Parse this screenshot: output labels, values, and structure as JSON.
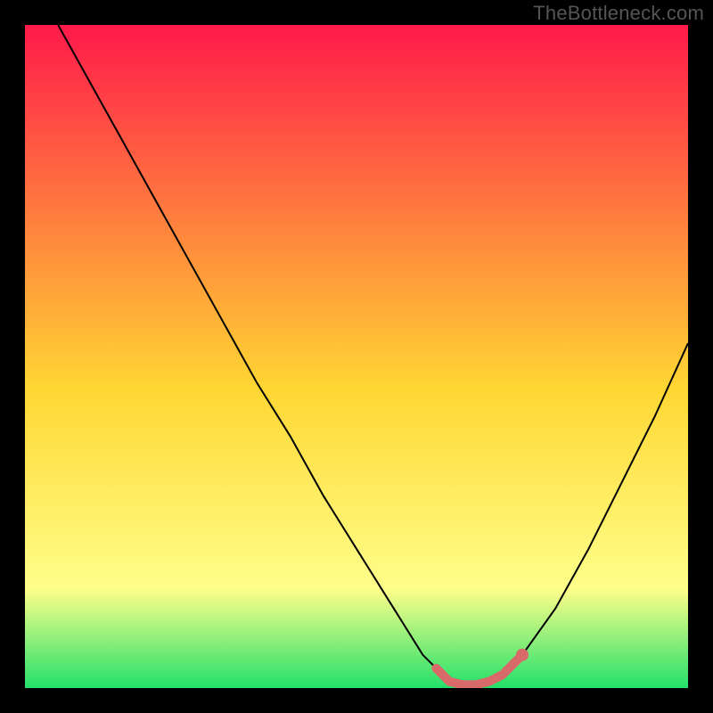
{
  "watermark": "TheBottleneck.com",
  "colors": {
    "background": "#000000",
    "gradient_top": "#ff1a4a",
    "gradient_mid": "#ffd733",
    "gradient_low": "#ffff8a",
    "gradient_bottom": "#23e06a",
    "curve_stroke": "#000000",
    "marker_fill": "#d96a6a",
    "marker_stroke": "#d96a6a"
  },
  "chart_data": {
    "type": "line",
    "title": "",
    "xlabel": "",
    "ylabel": "",
    "xlim": [
      0,
      100
    ],
    "ylim": [
      0,
      100
    ],
    "x": [
      5,
      10,
      15,
      20,
      25,
      30,
      35,
      40,
      45,
      50,
      55,
      60,
      62,
      64,
      66,
      68,
      70,
      72,
      75,
      80,
      85,
      90,
      95,
      100
    ],
    "series": [
      {
        "name": "curve",
        "values": [
          100,
          91,
          82,
          73,
          64,
          55,
          46,
          38,
          29,
          21,
          13,
          5,
          3,
          1,
          0.5,
          0.5,
          1,
          2,
          5,
          12,
          21,
          31,
          41,
          52
        ]
      }
    ],
    "markers": {
      "name": "highlighted-range",
      "x": [
        62,
        64,
        66,
        68,
        70,
        72,
        75
      ],
      "y": [
        3,
        1,
        0.5,
        0.5,
        1,
        2,
        5
      ]
    }
  }
}
